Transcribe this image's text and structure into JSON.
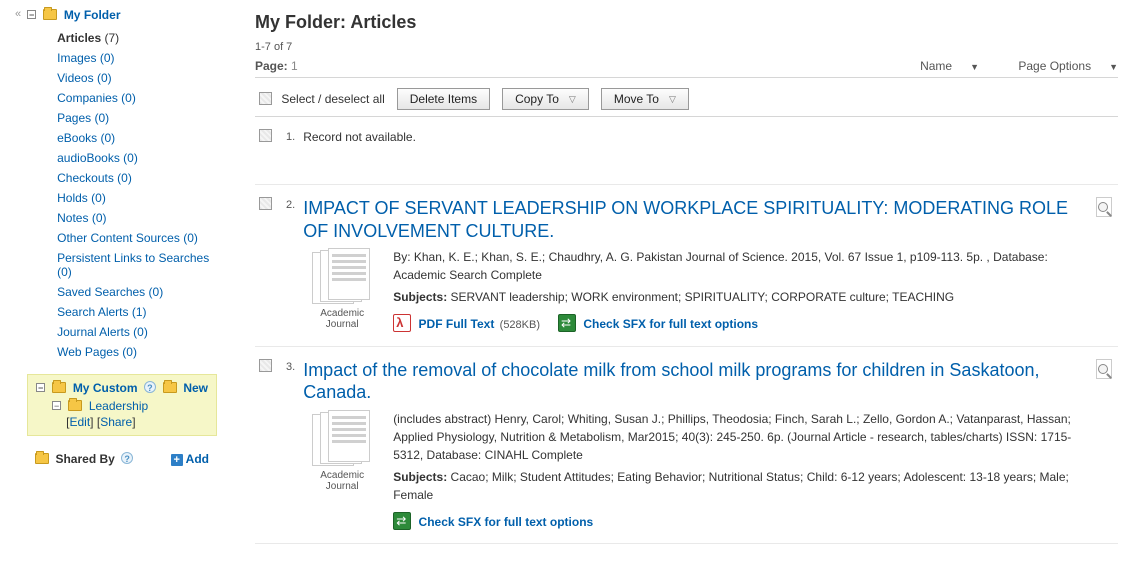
{
  "sidebar": {
    "collapse_glyph": "«",
    "root_label": "My Folder",
    "items": [
      {
        "label": "Articles",
        "count": "(7)",
        "bold": true
      },
      {
        "label": "Images",
        "count": "(0)"
      },
      {
        "label": "Videos",
        "count": "(0)"
      },
      {
        "label": "Companies",
        "count": "(0)"
      },
      {
        "label": "Pages",
        "count": "(0)"
      },
      {
        "label": "eBooks",
        "count": "(0)"
      },
      {
        "label": "audioBooks",
        "count": "(0)"
      },
      {
        "label": "Checkouts",
        "count": "(0)"
      },
      {
        "label": "Holds",
        "count": "(0)"
      },
      {
        "label": "Notes",
        "count": "(0)"
      },
      {
        "label": "Other Content Sources",
        "count": "(0)"
      },
      {
        "label": "Persistent Links to Searches",
        "count": "(0)"
      },
      {
        "label": "Saved Searches",
        "count": "(0)"
      },
      {
        "label": "Search Alerts",
        "count": "(1)"
      },
      {
        "label": "Journal Alerts",
        "count": "(0)"
      },
      {
        "label": "Web Pages",
        "count": "(0)"
      }
    ],
    "custom": {
      "label": "My Custom",
      "new_label": "New",
      "sub_label": "Leadership",
      "edit_label": "Edit",
      "share_label": "Share"
    },
    "shared": {
      "label": "Shared By",
      "add_label": "Add"
    }
  },
  "main": {
    "heading": "My Folder: Articles",
    "range": "1-7 of 7",
    "page_label": "Page:",
    "page_value": "1",
    "sort": {
      "name": "Name",
      "page_options": "Page Options"
    },
    "toolbar": {
      "select_all": "Select / deselect all",
      "delete": "Delete Items",
      "copy": "Copy To",
      "move": "Move To"
    },
    "results": [
      {
        "index": "1.",
        "unavailable": true,
        "unavailable_text": "Record not available."
      },
      {
        "index": "2.",
        "title": "IMPACT OF SERVANT LEADERSHIP ON WORKPLACE SPIRITUALITY: MODERATING ROLE OF INVOLVEMENT CULTURE.",
        "type_label": "Academic Journal",
        "byline": "By: Khan, K. E.; Khan, S. E.; Chaudhry, A. G. Pakistan Journal of Science. 2015, Vol. 67 Issue 1, p109-113. 5p. , Database: Academic Search Complete",
        "subjects_label": "Subjects:",
        "subjects": " SERVANT leadership; WORK environment; SPIRITUALITY; CORPORATE culture; TEACHING",
        "pdf_label": "PDF Full Text",
        "pdf_size": "(528KB)",
        "sfx_label": "Check SFX for full text options"
      },
      {
        "index": "3.",
        "title": "Impact of the removal of chocolate milk from school milk programs for children in Saskatoon, Canada.",
        "type_label": "Academic Journal",
        "byline": "(includes abstract) Henry, Carol; Whiting, Susan J.; Phillips, Theodosia; Finch, Sarah L.; Zello, Gordon A.; Vatanparast, Hassan; Applied Physiology, Nutrition & Metabolism, Mar2015; 40(3): 245-250. 6p. (Journal Article - research, tables/charts) ISSN: 1715-5312, Database: CINAHL Complete",
        "subjects_label": "Subjects:",
        "subjects": " Cacao; Milk; Student Attitudes; Eating Behavior; Nutritional Status; Child: 6-12 years; Adolescent: 13-18 years; Male; Female",
        "sfx_label": "Check SFX for full text options"
      }
    ]
  }
}
